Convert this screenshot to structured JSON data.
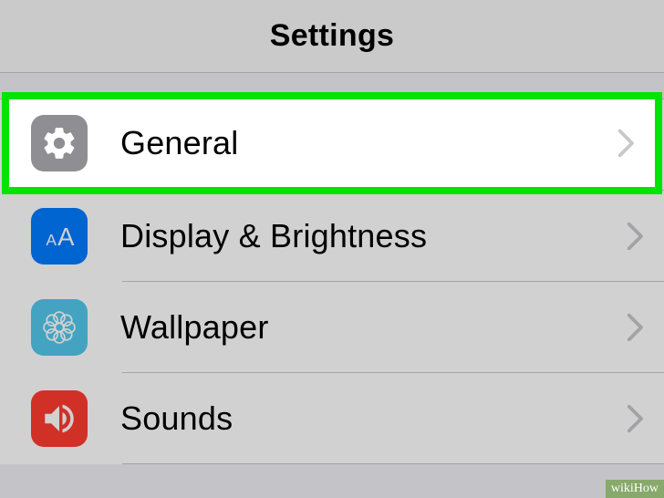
{
  "header": {
    "title": "Settings"
  },
  "rows": [
    {
      "id": "general",
      "label": "General"
    },
    {
      "id": "display",
      "label": "Display & Brightness"
    },
    {
      "id": "wallpaper",
      "label": "Wallpaper"
    },
    {
      "id": "sounds",
      "label": "Sounds"
    }
  ],
  "highlighted": "general",
  "watermark": "wikiHow"
}
